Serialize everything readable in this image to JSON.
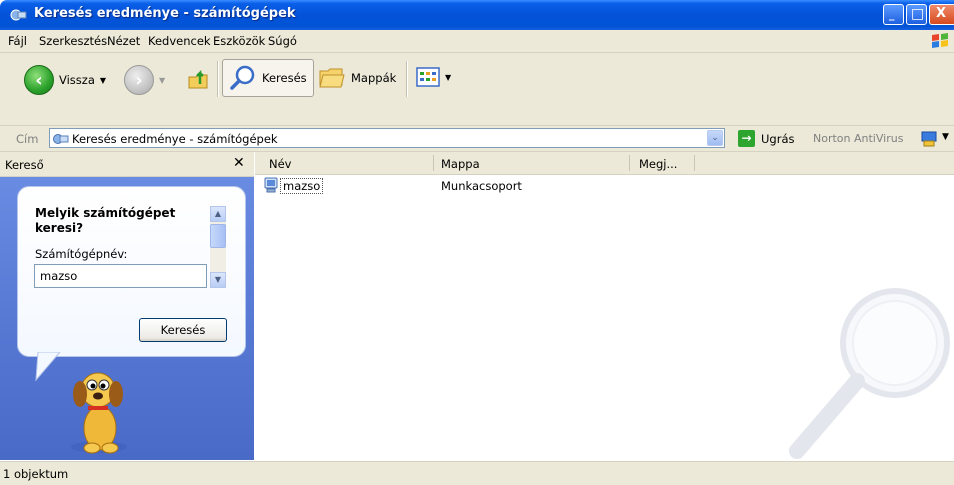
{
  "window": {
    "title": "Keresés eredménye - számítógépek",
    "minimize": "_",
    "maximize": "□",
    "close": "X"
  },
  "menu": [
    {
      "label": "Fájl"
    },
    {
      "label": "Szerkesztés"
    },
    {
      "label": "Nézet"
    },
    {
      "label": "Kedvencek"
    },
    {
      "label": "Eszközök"
    },
    {
      "label": "Súgó"
    }
  ],
  "toolbar": {
    "back_label": "Vissza",
    "back_arrow": "‹",
    "forward_arrow": "›",
    "search_label": "Keresés",
    "folders_label": "Mappák",
    "dropdown_mark": "▼"
  },
  "address": {
    "label": "Cím",
    "value": "Keresés eredménye - számítógépek",
    "dropdown": "⌄",
    "go_label": "Ugrás",
    "go_arrow": "→",
    "norton": "Norton AntiVirus",
    "norton_dd": "▼"
  },
  "search_pane": {
    "header": "Kereső",
    "close": "✕",
    "question": "Melyik számítógépet keresi?",
    "field_label": "Számítógépnév:",
    "field_value": "mazso",
    "button_label": "Keresés",
    "scroll_up": "▲",
    "scroll_down": "▼"
  },
  "columns": [
    "Név",
    "Mappa",
    "Megj..."
  ],
  "results": [
    {
      "name": "mazso",
      "folder": "Munkacsoport"
    }
  ],
  "status": "1 objektum",
  "colors": {
    "titlebar": "#0352d8",
    "chrome": "#ece9d8",
    "left_pane": "#6c8ee4"
  }
}
